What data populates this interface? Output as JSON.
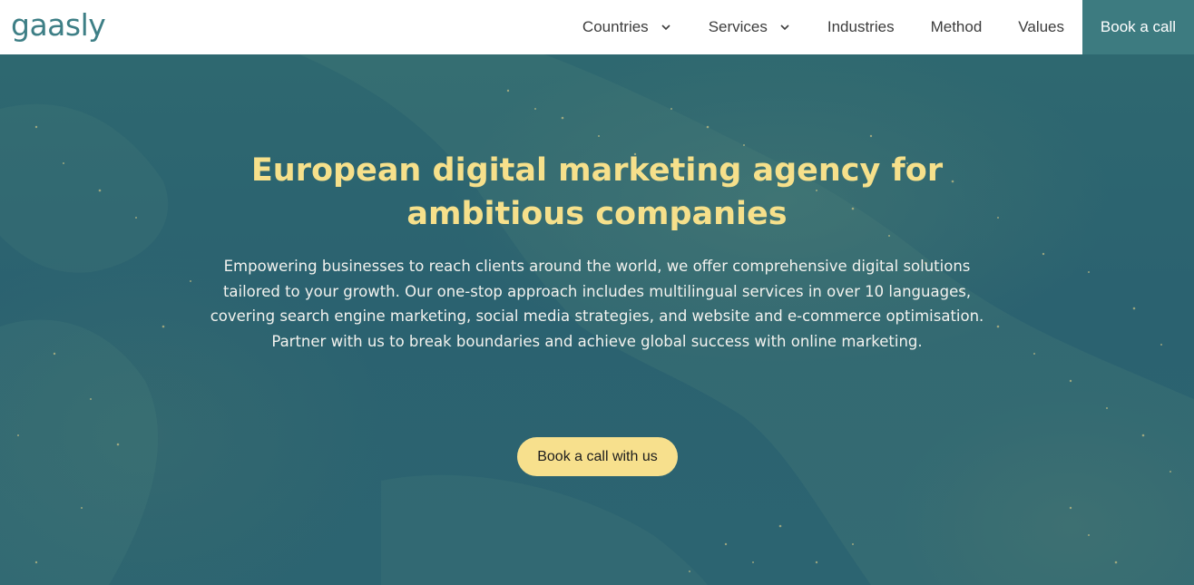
{
  "brand": {
    "logo_text": "gaasly",
    "logo_color": "#3e7f86"
  },
  "nav": {
    "items": [
      {
        "label": "Countries",
        "has_dropdown": true
      },
      {
        "label": "Services",
        "has_dropdown": true
      },
      {
        "label": "Industries",
        "has_dropdown": false
      },
      {
        "label": "Method",
        "has_dropdown": false
      },
      {
        "label": "Values",
        "has_dropdown": false
      }
    ],
    "cta_label": "Book a call",
    "cta_color": "#3d7b80"
  },
  "hero": {
    "title": "European digital marketing agency for ambitious companies",
    "description": "Empowering businesses to reach clients around the world, we offer comprehensive digital solutions tailored to your growth. Our one-stop approach includes multilingual services in over 10 languages, covering search engine marketing, social media strategies, and website and e-commerce optimisation. Partner with us to break boundaries and achieve global success with online marketing.",
    "button_label": "Book a call with us",
    "accent_color": "#f6e08b",
    "background_color": "#2e6870"
  }
}
